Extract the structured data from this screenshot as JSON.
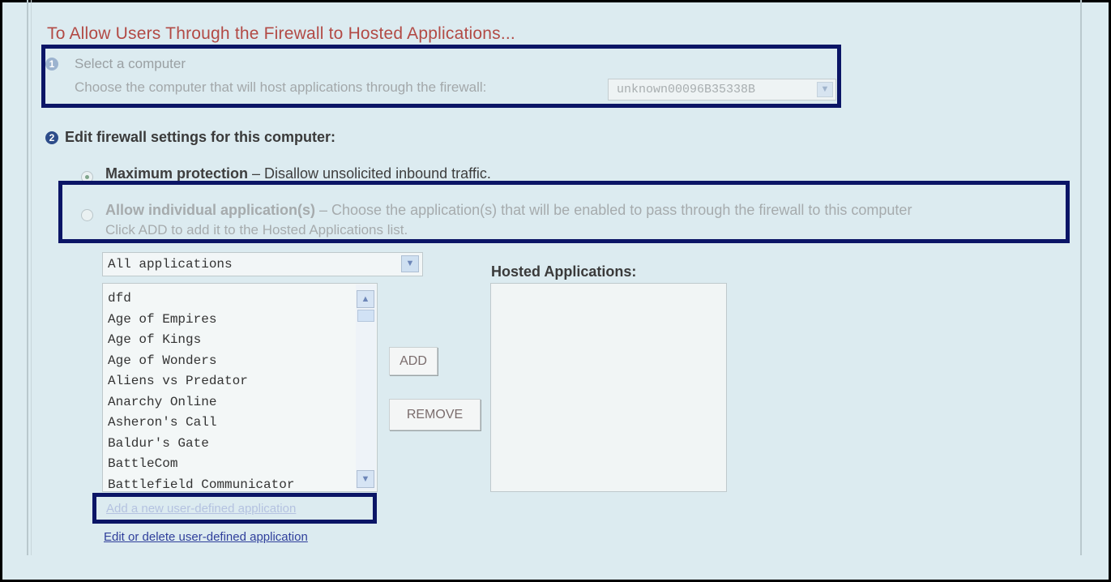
{
  "heading": "To Allow Users Through the Firewall to Hosted Applications...",
  "step1": {
    "number": "1",
    "title": "Select a computer",
    "description": "Choose the computer that will host applications through the firewall:",
    "computer_value": "unknown00096B35338B"
  },
  "step2": {
    "number": "2",
    "title": "Edit firewall settings for this computer:",
    "option_max": {
      "label": "Maximum protection",
      "desc": " – Disallow unsolicited inbound traffic.",
      "selected": true
    },
    "option_allow": {
      "label": "Allow individual application(s)",
      "desc": " – Choose the application(s) that will be enabled to pass through the firewall to this computer",
      "line2": "Click ADD to add it to the Hosted Applications list.",
      "selected": false
    }
  },
  "category_select": {
    "value": "All applications"
  },
  "applications": [
    "dfd",
    "Age of Empires",
    "Age of Kings",
    "Age of Wonders",
    "Aliens vs Predator",
    "Anarchy Online",
    "Asheron's Call",
    "Baldur's Gate",
    "BattleCom",
    "Battlefield Communicator"
  ],
  "buttons": {
    "add": "ADD",
    "remove": "REMOVE"
  },
  "hosted": {
    "label": "Hosted Applications:",
    "items": []
  },
  "links": {
    "add_new": "Add a new user-defined application",
    "edit_delete": "Edit or delete user-defined application"
  }
}
